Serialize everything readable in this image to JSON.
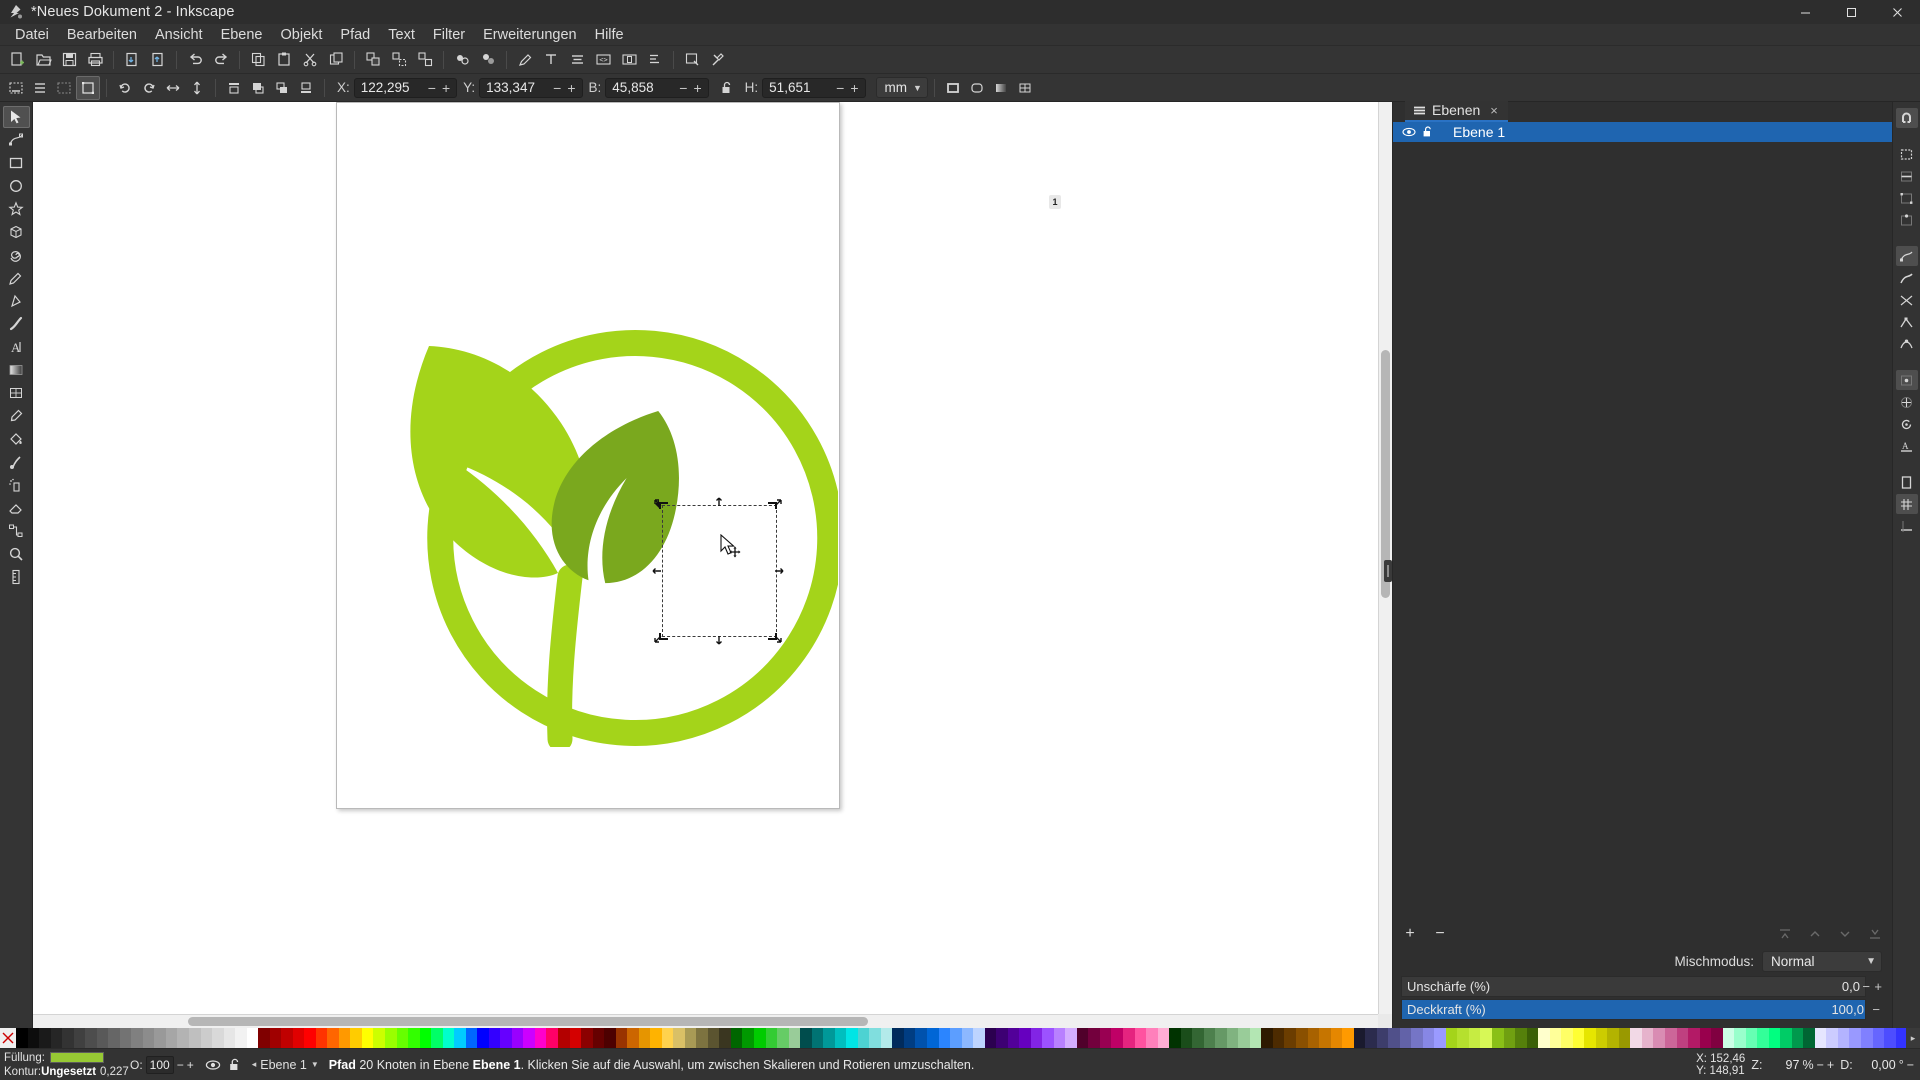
{
  "window": {
    "title": "*Neues Dokument 2 - Inkscape",
    "minimize": "Minimieren",
    "maximize": "Maximieren",
    "close": "Schließen"
  },
  "menu": {
    "items": [
      {
        "label": "Datei"
      },
      {
        "label": "Bearbeiten"
      },
      {
        "label": "Ansicht"
      },
      {
        "label": "Ebene"
      },
      {
        "label": "Objekt"
      },
      {
        "label": "Pfad"
      },
      {
        "label": "Text"
      },
      {
        "label": "Filter"
      },
      {
        "label": "Erweiterungen"
      },
      {
        "label": "Hilfe"
      }
    ]
  },
  "commandbar": {
    "buttons": [
      {
        "name": "new-document",
        "icon": "page-plus"
      },
      {
        "name": "open-document",
        "icon": "folder-open"
      },
      {
        "name": "save-document",
        "icon": "save"
      },
      {
        "name": "print-document",
        "icon": "printer"
      },
      {
        "name": "import",
        "icon": "import"
      },
      {
        "name": "export",
        "icon": "export"
      },
      {
        "name": "undo",
        "icon": "undo"
      },
      {
        "name": "redo",
        "icon": "redo"
      },
      {
        "name": "copy",
        "icon": "copy"
      },
      {
        "name": "paste",
        "icon": "paste"
      },
      {
        "name": "cut",
        "icon": "scissors"
      },
      {
        "name": "duplicate",
        "icon": "duplicate"
      },
      {
        "name": "group",
        "icon": "group"
      },
      {
        "name": "ungroup",
        "icon": "ungroup"
      },
      {
        "name": "ungroup-all",
        "icon": "ungroup2"
      },
      {
        "name": "fill-stroke-dialog",
        "icon": "fill-stroke"
      },
      {
        "name": "object-properties",
        "icon": "object-props"
      },
      {
        "name": "edit-paths-by-nodes",
        "icon": "pen"
      },
      {
        "name": "text-tool-dialog",
        "icon": "text"
      },
      {
        "name": "align-dialog",
        "icon": "align-lines"
      },
      {
        "name": "xml-editor",
        "icon": "xml"
      },
      {
        "name": "document-properties",
        "icon": "doc-props"
      },
      {
        "name": "text-and-font",
        "icon": "text-font"
      },
      {
        "name": "preferences",
        "icon": "wrench"
      }
    ]
  },
  "toolcontrols": {
    "select_all_button": "Alles auswählen",
    "select_all_layers_button": "Alles in allen Ebenen auswählen",
    "deselect_button": "Auswahl aufheben",
    "rotate_ccw": "90° gegen Uhrzeigersinn drehen",
    "rotate_cw": "90° im Uhrzeigersinn drehen",
    "flip_h": "Horizontal spiegeln",
    "flip_v": "Vertikal spiegeln",
    "raise_to_top": "Ganz nach oben",
    "raise": "Eine Stufe nach oben",
    "lower": "Eine Stufe nach unten",
    "lower_to_bottom": "Ganz nach unten",
    "x": {
      "label": "X:",
      "value": "122,295"
    },
    "y": {
      "label": "Y:",
      "value": "133,347"
    },
    "w": {
      "label": "B:",
      "value": "45,858"
    },
    "h": {
      "label": "H:",
      "value": "51,651"
    },
    "lock_ratio": "Breite und Höhe sperren",
    "units": "mm",
    "minus": "−",
    "plus": "+",
    "affect_stroke": "Linienbreite skalieren",
    "affect_corners": "Abgerundete Ecken skalieren",
    "affect_gradient": "Farbverläufe transformieren",
    "affect_pattern": "Muster transformieren"
  },
  "toolbox": {
    "tools": [
      {
        "name": "selector-tool",
        "icon": "arrow",
        "active": true
      },
      {
        "name": "node-tool",
        "icon": "node"
      },
      {
        "name": "rectangle-tool",
        "icon": "square"
      },
      {
        "name": "ellipse-tool",
        "icon": "circle"
      },
      {
        "name": "star-tool",
        "icon": "star"
      },
      {
        "name": "3dbox-tool",
        "icon": "cube"
      },
      {
        "name": "spiral-tool",
        "icon": "spiral"
      },
      {
        "name": "pencil-tool",
        "icon": "pencil"
      },
      {
        "name": "pen-tool",
        "icon": "bezier"
      },
      {
        "name": "calligraphy-tool",
        "icon": "calligraphy"
      },
      {
        "name": "text-tool",
        "icon": "letter-a"
      },
      {
        "name": "gradient-tool",
        "icon": "gradient"
      },
      {
        "name": "mesh-tool",
        "icon": "mesh"
      },
      {
        "name": "dropper-tool",
        "icon": "dropper"
      },
      {
        "name": "paintbucket-tool",
        "icon": "bucket"
      },
      {
        "name": "tweak-tool",
        "icon": "tweak"
      },
      {
        "name": "spray-tool",
        "icon": "spray"
      },
      {
        "name": "eraser-tool",
        "icon": "eraser"
      },
      {
        "name": "connector-tool",
        "icon": "connector"
      },
      {
        "name": "zoom-tool",
        "icon": "magnifier"
      },
      {
        "name": "measure-tool",
        "icon": "ruler"
      }
    ]
  },
  "canvas": {
    "page_badge": "1",
    "artwork_name": "leaf-logo-artwork",
    "colors": {
      "outer_leaf": "#a4d41a",
      "inner_leaf": "#7aa81e",
      "ring": "#a4d41a"
    }
  },
  "dock": {
    "tab": {
      "label": "Ebenen",
      "close": "×"
    },
    "layers": [
      {
        "name": "Ebene 1",
        "visible": true,
        "locked": false,
        "selected": true
      }
    ],
    "buttons": {
      "add_layer": "+",
      "remove_layer": "−",
      "layer_to_top": "Ebene nach ganz oben",
      "layer_up": "Ebene anheben",
      "layer_down": "Ebene absenken",
      "layer_to_bottom": "Ebene nach ganz unten"
    },
    "blend": {
      "label": "Mischmodus:",
      "value": "Normal"
    },
    "blur": {
      "label": "Unschärfe (%)",
      "value": "0,0",
      "percent": 0
    },
    "opacity": {
      "label": "Deckkraft (%)",
      "value": "100,0",
      "percent": 100
    }
  },
  "snapbar": {
    "buttons": [
      {
        "name": "snap-enable-toggle",
        "icon": "magnet"
      },
      {
        "name": "snap-bounding-box",
        "icon": "bbox"
      },
      {
        "name": "snap-bbox-edges",
        "icon": "bbox-edge"
      },
      {
        "name": "snap-bbox-corners",
        "icon": "bbox-corner"
      },
      {
        "name": "snap-bbox-edge-midpoints",
        "icon": "bbox-mid"
      },
      {
        "name": "snap-nodes",
        "icon": "node-snap"
      },
      {
        "name": "snap-paths",
        "icon": "path-snap"
      },
      {
        "name": "snap-path-intersections",
        "icon": "path-inter"
      },
      {
        "name": "snap-cusp-nodes",
        "icon": "cusp"
      },
      {
        "name": "snap-smooth-nodes",
        "icon": "smooth"
      },
      {
        "name": "snap-object-midpoints",
        "icon": "obj-mid"
      },
      {
        "name": "snap-object-centers",
        "icon": "obj-center"
      },
      {
        "name": "snap-rotation-centers",
        "icon": "rot-center"
      },
      {
        "name": "snap-text-baselines",
        "icon": "text-base"
      },
      {
        "name": "snap-page-border",
        "icon": "page-border"
      },
      {
        "name": "snap-grids",
        "icon": "grid"
      },
      {
        "name": "snap-guides",
        "icon": "guide"
      }
    ]
  },
  "palette": {
    "none_swatch": "X",
    "more_arrow": "▸",
    "swatches": [
      "#000000",
      "#0d0d0d",
      "#1a1a1a",
      "#262626",
      "#333333",
      "#404040",
      "#4d4d4d",
      "#595959",
      "#666666",
      "#737373",
      "#808080",
      "#8c8c8c",
      "#999999",
      "#a6a6a6",
      "#b3b3b3",
      "#bfbfbf",
      "#cccccc",
      "#d9d9d9",
      "#e6e6e6",
      "#f2f2f2",
      "#ffffff",
      "#800000",
      "#a00000",
      "#c00000",
      "#e00000",
      "#ff0000",
      "#ff3300",
      "#ff6600",
      "#ff9900",
      "#ffcc00",
      "#ffff00",
      "#ccff00",
      "#99ff00",
      "#66ff00",
      "#33ff00",
      "#00ff00",
      "#00ff66",
      "#00ffcc",
      "#00ccff",
      "#0066ff",
      "#0000ff",
      "#3300ff",
      "#6600ff",
      "#9900ff",
      "#cc00ff",
      "#ff00cc",
      "#ff0066",
      "#b30000",
      "#d40000",
      "#8b0000",
      "#660000",
      "#4d0000",
      "#993300",
      "#cc6600",
      "#e69500",
      "#ffb300",
      "#ffd24d",
      "#d9c066",
      "#a89a55",
      "#7d7340",
      "#5b5430",
      "#3a3620",
      "#006600",
      "#009900",
      "#00cc00",
      "#33cc33",
      "#66cc66",
      "#99cc99",
      "#004d4d",
      "#007373",
      "#009999",
      "#00bfbf",
      "#00e5e5",
      "#4dd2d2",
      "#80dede",
      "#b3eaea",
      "#002b5c",
      "#003d82",
      "#0052ad",
      "#0066d6",
      "#2b85ff",
      "#5c9eff",
      "#8cb8ff",
      "#bdd4ff",
      "#2b0050",
      "#3d0073",
      "#520099",
      "#6600bf",
      "#8224e5",
      "#9c52ff",
      "#b880ff",
      "#d4adff",
      "#50002b",
      "#73003d",
      "#990052",
      "#bf0066",
      "#e5247f",
      "#ff52a0",
      "#ff80bb",
      "#ffadd4",
      "#003300",
      "#1a4d1a",
      "#336633",
      "#4d804d",
      "#669966",
      "#80b380",
      "#99cc99",
      "#b3e6b3",
      "#2e1a00",
      "#4d2b00",
      "#6b3d00",
      "#8a5000",
      "#a86200",
      "#c67500",
      "#e58700",
      "#ff9a00",
      "#1a1a2e",
      "#2b2b4d",
      "#3d3d6b",
      "#50508a",
      "#6262a8",
      "#7575c6",
      "#8787e5",
      "#9a9aff",
      "#a4d41a",
      "#b5e02e",
      "#c6ec42",
      "#d7f856",
      "#8ac017",
      "#70a011",
      "#55800b",
      "#3b6006",
      "#ffffcc",
      "#ffff99",
      "#ffff66",
      "#ffff33",
      "#e6e600",
      "#cccc00",
      "#b3b300",
      "#999900",
      "#f2d9e6",
      "#e6b3cc",
      "#d98cb3",
      "#cc6699",
      "#bf4080",
      "#b31a66",
      "#99004d",
      "#800040",
      "#ccffe6",
      "#99ffcc",
      "#66ffb3",
      "#33ff99",
      "#00ff80",
      "#00cc66",
      "#00994d",
      "#006633",
      "#e6e6ff",
      "#ccccff",
      "#b3b3ff",
      "#9999ff",
      "#8080ff",
      "#6666ff",
      "#4d4dff",
      "#3333ff"
    ]
  },
  "statusbar": {
    "fill": {
      "label": "Füllung:",
      "swatch_color": "#97c934"
    },
    "stroke": {
      "label": "Kontur:",
      "value": "Ungesetzt",
      "width": "0,227"
    },
    "opacity": {
      "label": "O:",
      "value": "100",
      "minus": "−",
      "plus": "+"
    },
    "visibility_icon": "eye-icon",
    "lock_icon": "unlock-icon",
    "layer_indicator": "Ebene 1",
    "message": {
      "object": "Pfad",
      "detail_1": "20 Knoten in Ebene",
      "layer": "Ebene 1",
      "detail_2": ". Klicken Sie auf die Auswahl, um zwischen Skalieren und Rotieren umzuschalten."
    },
    "pointer": {
      "x_label": "X:",
      "x": "152,46",
      "y_label": "Y:",
      "y": "148,91"
    },
    "zoom": {
      "label": "Z:",
      "value": "97",
      "unit": "%",
      "minus": "−",
      "plus": "+"
    },
    "rotation": {
      "label": "D:",
      "value": "0,00",
      "unit": "°",
      "minus": "−"
    }
  }
}
